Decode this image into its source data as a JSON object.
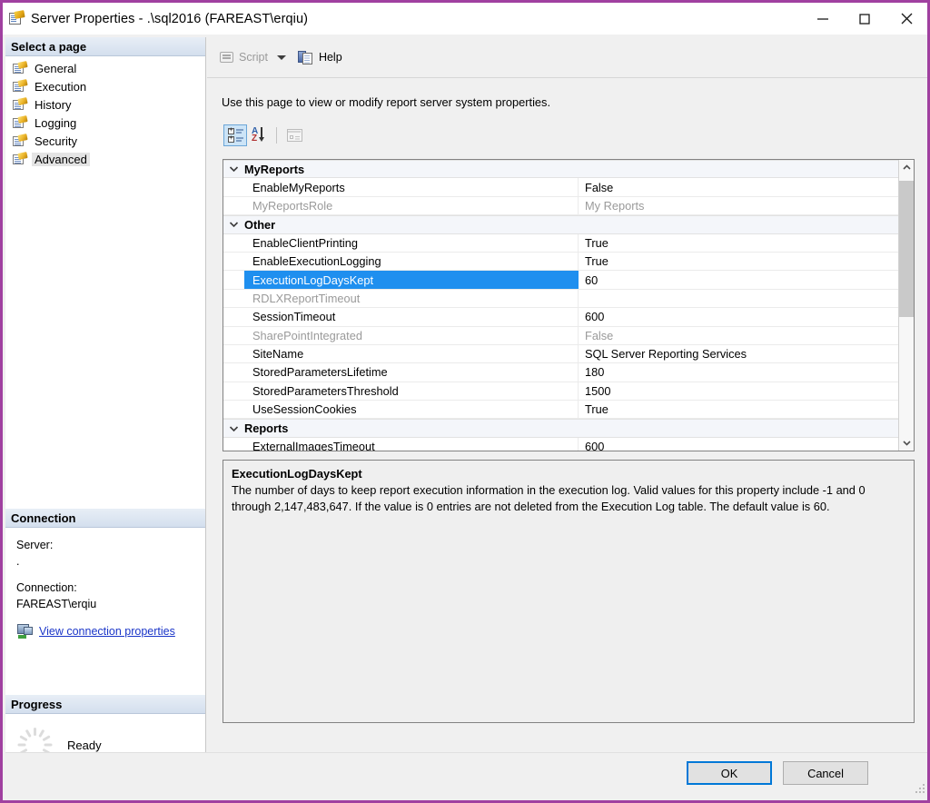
{
  "window": {
    "title": "Server Properties - .\\sql2016 (FAREAST\\erqiu)",
    "icon": "server-properties-icon",
    "minimize_label": "Minimize",
    "maximize_label": "Maximize",
    "close_label": "Close",
    "frame_color": "#A040A0"
  },
  "sidebar": {
    "header": "Select a page",
    "items": [
      {
        "label": "General",
        "selected": false
      },
      {
        "label": "Execution",
        "selected": false
      },
      {
        "label": "History",
        "selected": false
      },
      {
        "label": "Logging",
        "selected": false
      },
      {
        "label": "Security",
        "selected": false
      },
      {
        "label": "Advanced",
        "selected": true
      }
    ],
    "connection": {
      "header": "Connection",
      "server_label": "Server:",
      "server_value": ".",
      "connection_label": "Connection:",
      "connection_value": "FAREAST\\erqiu",
      "link": "View connection properties"
    },
    "progress": {
      "header": "Progress",
      "status": "Ready"
    }
  },
  "command_bar": {
    "script_label": "Script",
    "script_disabled": true,
    "help_label": "Help"
  },
  "main": {
    "page_description": "Use this page to view or modify report server system properties.",
    "grid_toolbar": [
      {
        "name": "categorized-button",
        "tooltip": "Categorized",
        "active": true,
        "disabled": false
      },
      {
        "name": "alphabetical-button",
        "tooltip": "Alphabetical",
        "active": false,
        "disabled": false
      },
      {
        "name": "property-pages-button",
        "tooltip": "Property Pages",
        "active": false,
        "disabled": true
      }
    ],
    "grid": {
      "selected_row": "ExecutionLogDaysKept",
      "rows": [
        {
          "type": "category",
          "name": "MyReports",
          "expanded": true
        },
        {
          "type": "property",
          "name": "EnableMyReports",
          "value": "False",
          "dim": false
        },
        {
          "type": "property",
          "name": "MyReportsRole",
          "value": "My Reports",
          "dim": true
        },
        {
          "type": "category",
          "name": "Other",
          "expanded": true
        },
        {
          "type": "property",
          "name": "EnableClientPrinting",
          "value": "True",
          "dim": false
        },
        {
          "type": "property",
          "name": "EnableExecutionLogging",
          "value": "True",
          "dim": false
        },
        {
          "type": "property",
          "name": "ExecutionLogDaysKept",
          "value": "60",
          "dim": false,
          "selected": true
        },
        {
          "type": "property",
          "name": "RDLXReportTimeout",
          "value": "",
          "dim": true
        },
        {
          "type": "property",
          "name": "SessionTimeout",
          "value": "600",
          "dim": false
        },
        {
          "type": "property",
          "name": "SharePointIntegrated",
          "value": "False",
          "dim": true
        },
        {
          "type": "property",
          "name": "SiteName",
          "value": "SQL Server Reporting Services",
          "dim": false
        },
        {
          "type": "property",
          "name": "StoredParametersLifetime",
          "value": "180",
          "dim": false
        },
        {
          "type": "property",
          "name": "StoredParametersThreshold",
          "value": "1500",
          "dim": false
        },
        {
          "type": "property",
          "name": "UseSessionCookies",
          "value": "True",
          "dim": false
        },
        {
          "type": "category",
          "name": "Reports",
          "expanded": true
        },
        {
          "type": "property",
          "name": "ExternalImagesTimeout",
          "value": "600",
          "dim": false
        }
      ]
    },
    "description": {
      "title": "ExecutionLogDaysKept",
      "body": "The number of days to keep report execution information in the execution log. Valid values for this property include -1 and 0 through 2,147,483,647. If the value is 0 entries are not deleted from the Execution Log table. The default value is 60."
    }
  },
  "footer": {
    "ok_label": "OK",
    "cancel_label": "Cancel"
  }
}
